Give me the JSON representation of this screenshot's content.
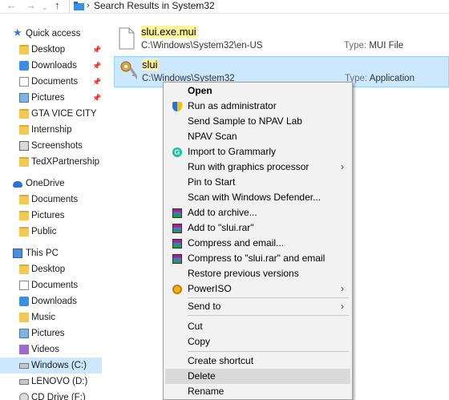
{
  "address_bar": {
    "back_icon": "arrow-left",
    "forward_icon": "arrow-right",
    "recent_icon": "chevron-down",
    "up_icon": "arrow-up",
    "location": "Search Results in System32"
  },
  "nav_pane": {
    "quick_access": {
      "label": "Quick access",
      "items": [
        {
          "label": "Desktop",
          "pinned": true,
          "icon": "desktop-folder"
        },
        {
          "label": "Downloads",
          "pinned": true,
          "icon": "downloads-folder"
        },
        {
          "label": "Documents",
          "pinned": true,
          "icon": "documents-folder"
        },
        {
          "label": "Pictures",
          "pinned": true,
          "icon": "pictures-folder"
        },
        {
          "label": "GTA VICE CITY",
          "icon": "folder"
        },
        {
          "label": "Internship",
          "icon": "folder"
        },
        {
          "label": "Screenshots",
          "icon": "screenshots-folder"
        },
        {
          "label": "TedXPartnership",
          "icon": "folder"
        }
      ]
    },
    "onedrive": {
      "label": "OneDrive",
      "items": [
        {
          "label": "Documents",
          "icon": "folder"
        },
        {
          "label": "Pictures",
          "icon": "folder"
        },
        {
          "label": "Public",
          "icon": "folder"
        }
      ]
    },
    "this_pc": {
      "label": "This PC",
      "items": [
        {
          "label": "Desktop",
          "icon": "desktop-folder"
        },
        {
          "label": "Documents",
          "icon": "documents-folder"
        },
        {
          "label": "Downloads",
          "icon": "downloads-folder"
        },
        {
          "label": "Music",
          "icon": "music-folder"
        },
        {
          "label": "Pictures",
          "icon": "pictures-folder"
        },
        {
          "label": "Videos",
          "icon": "videos-folder"
        },
        {
          "label": "Windows (C:)",
          "icon": "drive",
          "selected": true
        },
        {
          "label": "LENOVO (D:)",
          "icon": "drive"
        },
        {
          "label": "CD Drive (F:)",
          "icon": "cd-drive"
        }
      ]
    },
    "pin_glyph": "📌"
  },
  "files": [
    {
      "name": "slui.exe.mui",
      "path": "C:\\Windows\\System32\\en-US",
      "type_label": "Type:",
      "type": "MUI File",
      "selected": false
    },
    {
      "name": "slui",
      "path": "C:\\Windows\\System32",
      "type_label": "Type:",
      "type": "Application",
      "selected": true
    }
  ],
  "context_menu": {
    "items": [
      {
        "label": "Open",
        "bold": true
      },
      {
        "label": "Run as administrator",
        "icon": "uac-shield"
      },
      {
        "label": "Send Sample to NPAV Lab"
      },
      {
        "label": "NPAV Scan"
      },
      {
        "label": "Import to Grammarly",
        "icon": "grammarly"
      },
      {
        "label": "Run with graphics processor",
        "submenu": true
      },
      {
        "label": "Pin to Start"
      },
      {
        "label": "Scan with Windows Defender..."
      },
      {
        "label": "Add to archive...",
        "icon": "winrar"
      },
      {
        "label": "Add to \"slui.rar\"",
        "icon": "winrar"
      },
      {
        "label": "Compress and email...",
        "icon": "winrar"
      },
      {
        "label": "Compress to \"slui.rar\" and email",
        "icon": "winrar"
      },
      {
        "label": "Restore previous versions"
      },
      {
        "label": "PowerISO",
        "icon": "poweriso",
        "submenu": true
      },
      {
        "label": "Send to",
        "submenu": true
      },
      {
        "label": "Cut"
      },
      {
        "label": "Copy"
      },
      {
        "label": "Create shortcut"
      },
      {
        "label": "Delete",
        "hovered": true
      },
      {
        "label": "Rename"
      }
    ],
    "submenu_glyph": "›"
  },
  "colors": {
    "selection": "#cce8ff",
    "search_highlight": "#fff59a",
    "menu_background": "#f2f2f2",
    "menu_hover": "#dadada"
  }
}
